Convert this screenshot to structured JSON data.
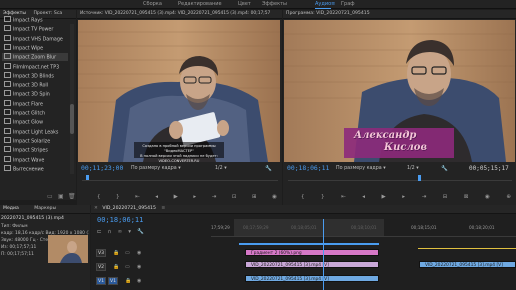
{
  "workspaces": [
    {
      "label": "Сборка",
      "active": false
    },
    {
      "label": "Редактирование",
      "active": false
    },
    {
      "label": "Цвет",
      "active": false
    },
    {
      "label": "Эффекты",
      "active": false
    },
    {
      "label": "Аудио",
      "active": true
    },
    {
      "label": "Граф",
      "active": false
    }
  ],
  "effects_panel": {
    "tabs": [
      "Эффекты",
      "Проект: Sca"
    ],
    "items": [
      "Impact Rays",
      "Impact TV Power",
      "Impact VHS Damage",
      "Impact Wipe",
      "Impact Zoom Blur",
      "FilmImpact.net TP3",
      "Impact 3D Blinds",
      "Impact 3D Roll",
      "Impact 3D Spin",
      "Impact Flare",
      "Impact Glitch",
      "Impact Glow",
      "Impact Light Leaks",
      "Impact Solarize",
      "Impact Stripes",
      "Impact Wave",
      "Вытеснение"
    ],
    "selected_index": 4
  },
  "source_monitor": {
    "title": "Источник: VID_20220721_095415 (3).mp4: VID_20220721_095415 (3).mp4: 00;17;57",
    "watermark_line1": "Создано в пробной версии программы \"ВидеоМАСТЕР\"",
    "watermark_line2": "В полной версии этой надписи не будет: VIDEO-CONVERTER.RU",
    "timecode": "00;11;23;00",
    "fit_label": "По размеру кадра",
    "page_label": "1/2",
    "scrub_progress": 0.02
  },
  "program_monitor": {
    "title": "Программа: VID_20220721_095415",
    "overlay_name_line1": "Александр",
    "overlay_name_line2": "Кислов",
    "timecode": "00;18;06;11",
    "fit_label": "По размеру кадра",
    "page_label": "1/2",
    "duration": "00;05;15;17",
    "playhead_progress": 0.58
  },
  "project_panel": {
    "tabs": [
      "Медиа",
      "Маркеры"
    ],
    "clip_name": "20220721_095415 (3).mp4",
    "info_lines": [
      "Тип: Фильм",
      "Вид: 1920 x 1080 (1,0)",
      "48000 Гц · Стерео · Сте",
      "00;17;57;11",
      "00;17;57;11"
    ],
    "info_prefixes": [
      "",
      "кадр: 18,16 кадр/с",
      "Звук:",
      "Из: ",
      "П:"
    ]
  },
  "timeline": {
    "sequence_tab": "VID_20220721_095415",
    "timecode": "00;18;06;11",
    "ruler_labels": [
      "17;59;29",
      "00;17;59;29",
      "00;18;05;01",
      "00;18;10;01",
      "00;18;15;01",
      "00;18;20;01"
    ],
    "tracks": [
      "V3",
      "V2",
      "V1"
    ],
    "clips": [
      {
        "label": "Градиент 2 (60%).png",
        "track": "V3",
        "color": "#d678c7"
      },
      {
        "label": "VID_20220721_095415 [3].mp4 [V]",
        "track": "V2",
        "color": "#c9a8d8"
      },
      {
        "label": "VID_20220721_095415 [3].mp4 [V]",
        "track": "V1",
        "color": "#6fa9e2"
      },
      {
        "label": "VID_20220721_095415 [3].mp4 [V]",
        "track": "V1b",
        "color": "#6fa9e2"
      }
    ]
  },
  "colors": {
    "accent": "#4a9cf0",
    "timeline_bg": "#1f1f1f"
  }
}
